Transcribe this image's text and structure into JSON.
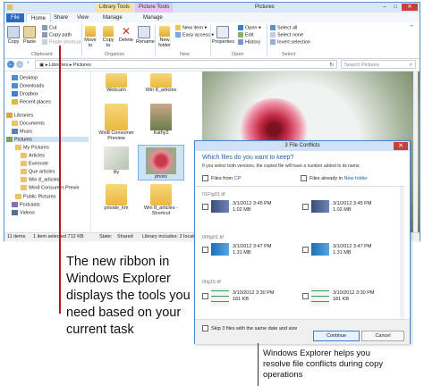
{
  "window": {
    "title": "Pictures",
    "context_groups": [
      "Library Tools",
      "Picture Tools"
    ],
    "tabs": [
      "File",
      "Home",
      "Share",
      "View",
      "Manage",
      "Manage"
    ],
    "ribbon": {
      "clipboard": {
        "copy": "Copy",
        "paste": "Paste",
        "cut": "Cut",
        "copy_path": "Copy path",
        "paste_shortcut": "Paste shortcut",
        "label": "Clipboard"
      },
      "organize": {
        "move_to": "Move to",
        "copy_to": "Copy to",
        "delete": "Delete",
        "rename": "Rename",
        "label": "Organize"
      },
      "new": {
        "new_folder": "New folder",
        "new_item": "New item",
        "easy_access": "Easy access",
        "label": "New"
      },
      "open": {
        "properties": "Properties",
        "open": "Open",
        "edit": "Edit",
        "history": "History",
        "label": "Open"
      },
      "select": {
        "select_all": "Select all",
        "select_none": "Select none",
        "invert": "Invert selection",
        "label": "Select"
      }
    },
    "address": {
      "path_1": "Libraries",
      "path_2": "Pictures",
      "search_placeholder": "Search Pictures"
    },
    "nav": [
      "Desktop",
      "Downloads",
      "Dropbox",
      "Recent places",
      "Libraries",
      "Documents",
      "Music",
      "Pictures",
      "My Pictures",
      "Articles",
      "Evernote",
      "Que articles",
      "Win 8_articles",
      "Win8 Consumer Previe",
      "Public Pictures",
      "Podcasts",
      "Videos"
    ],
    "files": [
      "Webcam",
      "Win 8_articles",
      "Win8 Consumer Preview",
      "Kathy2",
      "lily",
      "photo",
      "private_km",
      "Win 8_articles - Shortcut"
    ],
    "status": {
      "items": "11 items",
      "selected": "1 item selected  712 KB",
      "state": "State:",
      "shared": "Shared",
      "library": "Library includes: 2 locations"
    }
  },
  "dialog": {
    "title": "3 File Conflicts",
    "heading": "Which files do you want to keep?",
    "subtitle": "If you select both versions, the copied file will have a number added to its name.",
    "col_from_prefix": "Files from",
    "col_from_link": "CP",
    "col_already_prefix": "Files already in",
    "col_already_link": "New folder",
    "conflicts": [
      {
        "name": "01Fig01.tif",
        "left_date": "3/1/2012 3:45 PM",
        "left_size": "1.02 MB",
        "right_date": "3/1/2012 3:45 PM",
        "right_size": "1.02 MB"
      },
      {
        "name": "00fig01.tif",
        "left_date": "3/1/2012 3:47 PM",
        "left_size": "1.31 MB",
        "right_date": "3/1/2012 3:47 PM",
        "right_size": "1.31 MB"
      },
      {
        "name": "0fig15.tif",
        "left_date": "3/10/2012 3:30 PM",
        "left_size": "181 KB",
        "right_date": "3/10/2012 3:30 PM",
        "right_size": "181 KB"
      }
    ],
    "skip_label": "Skip 3 files with the same date and size",
    "continue": "Continue",
    "cancel": "Cancel"
  },
  "annotations": {
    "left": "The new ribbon in Windows Explorer displays the tools you need based on your current task",
    "right": "Windows Explorer helps you resolve file conflicts during copy operations"
  },
  "colors": {
    "accent": "#2a6cc2",
    "annotation_line": "#c0141c"
  }
}
